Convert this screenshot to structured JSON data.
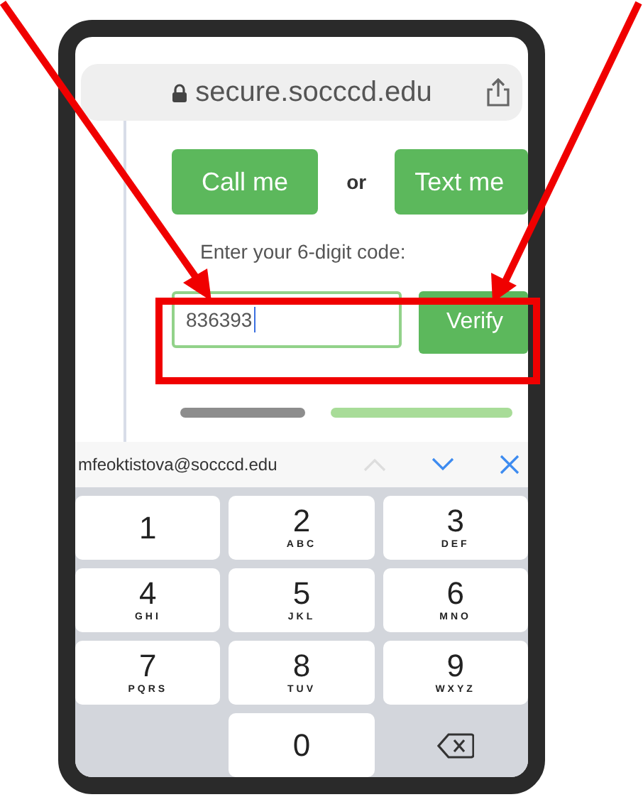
{
  "browser": {
    "url": "secure.socccd.edu"
  },
  "page": {
    "call_button": "Call me",
    "separator": "or",
    "text_button": "Text me",
    "instruction": "Enter your 6-digit code:",
    "code_field": {
      "value": "836393"
    },
    "verify_button": "Verify"
  },
  "keyboard": {
    "autofill": "mfeoktistova@socccd.edu",
    "keys": [
      {
        "kind": "digit",
        "digit": "1"
      },
      {
        "kind": "digit",
        "digit": "2",
        "letters": "ABC"
      },
      {
        "kind": "digit",
        "digit": "3",
        "letters": "DEF"
      },
      {
        "kind": "digit",
        "digit": "4",
        "letters": "GHI"
      },
      {
        "kind": "digit",
        "digit": "5",
        "letters": "JKL"
      },
      {
        "kind": "digit",
        "digit": "6",
        "letters": "MNO"
      },
      {
        "kind": "digit",
        "digit": "7",
        "letters": "PQRS"
      },
      {
        "kind": "digit",
        "digit": "8",
        "letters": "TUV"
      },
      {
        "kind": "digit",
        "digit": "9",
        "letters": "WXYZ"
      },
      {
        "kind": "blank"
      },
      {
        "kind": "digit",
        "digit": "0"
      },
      {
        "kind": "delete"
      }
    ]
  }
}
